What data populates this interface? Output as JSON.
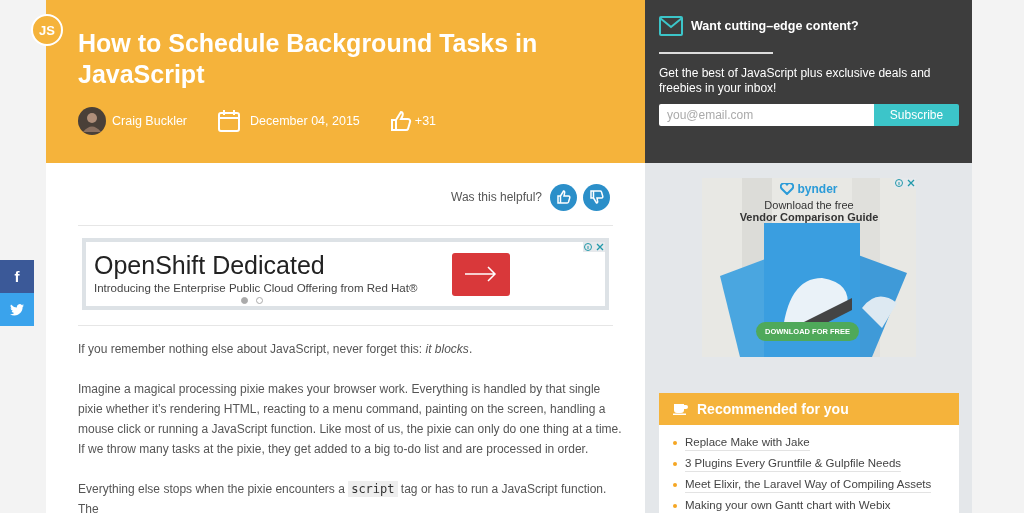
{
  "logo": {
    "text": "JS"
  },
  "article": {
    "title": "How to Schedule Background Tasks in JavaScript",
    "author": "Craig Buckler",
    "date": "December 04, 2015",
    "likes": "+31"
  },
  "newsletter": {
    "heading": "Want cutting–edge content?",
    "text": "Get the best of JavaScript plus exclusive deals and freebies in your inbox!",
    "placeholder": "you@email.com",
    "button": "Subscribe"
  },
  "feedback": {
    "question": "Was this helpful?"
  },
  "ad": {
    "headline": "OpenShift Dedicated",
    "text": "Introducing the Enterprise Public Cloud Offering from Red Hat®",
    "pages": [
      {
        "selected": true
      },
      {
        "selected": false
      }
    ]
  },
  "paragraphs": [
    {
      "segments": [
        {
          "kind": "text",
          "text": "If you remember nothing else about JavaScript, never forget this: *it blocks*."
        }
      ]
    },
    {
      "segments": [
        {
          "kind": "text",
          "text": "Imagine a magical processing pixie makes your browser work. Everything is handled by that single pixie whether it’s rendering HTML, reacting to a menu command, painting on the screen, handling a mouse click or running a JavaScript function. Like most of us, the pixie can only do one thing at a time. If we throw many tasks at the pixie, they get added to a big to-do list and are processed in order."
        }
      ]
    },
    {
      "segments": [
        {
          "kind": "text",
          "text": "Everything else stops when the pixie encounters a "
        },
        {
          "kind": "code",
          "text": "script"
        },
        {
          "kind": "text",
          "text": " tag or has to run a JavaScript function. The"
        }
      ]
    }
  ],
  "sidebar_ad": {
    "brand": "bynder",
    "line1": "Download the free",
    "line2": "Vendor Comparison Guide",
    "button": "DOWNLOAD FOR FREE"
  },
  "recommended": {
    "title": "Recommended for you",
    "items": [
      "Replace Make with Jake",
      "3 Plugins Every Gruntfile & Gulpfile Needs",
      "Meet Elixir, the Laravel Way of Compiling Assets",
      "Making your own Gantt chart with Webix"
    ]
  },
  "social": [
    {
      "kind": "facebook",
      "label": "f"
    },
    {
      "kind": "twitter"
    }
  ]
}
